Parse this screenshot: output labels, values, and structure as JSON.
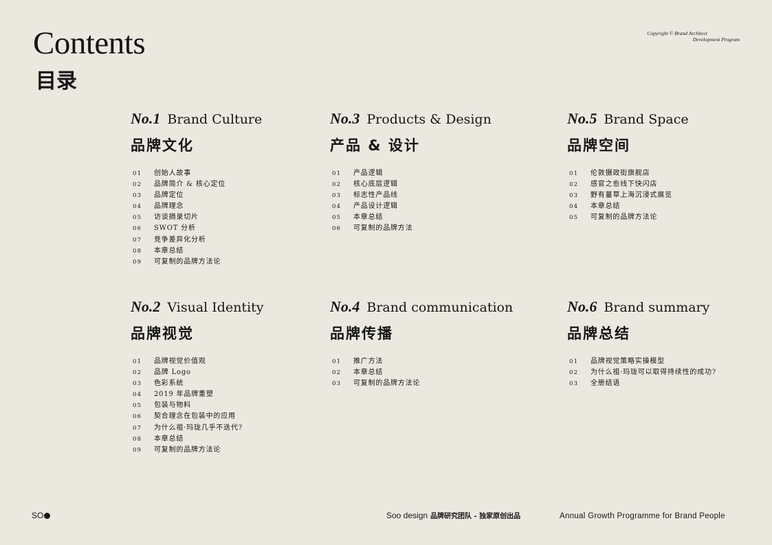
{
  "header": {
    "title_en": "Contents",
    "title_zh": "目录",
    "copyright_line1": "Copyright © Brand Architect",
    "copyright_line2": "Development Program"
  },
  "sections": [
    {
      "no": "No.1",
      "name": "Brand Culture",
      "zh": "品牌文化",
      "items": [
        {
          "num": "01",
          "label": "创始人故事"
        },
        {
          "num": "02",
          "label": "品牌简介 & 核心定位"
        },
        {
          "num": "03",
          "label": "品牌定位"
        },
        {
          "num": "04",
          "label": "品牌理念"
        },
        {
          "num": "05",
          "label": "访谈摘录切片"
        },
        {
          "num": "06",
          "label": "SWOT 分析"
        },
        {
          "num": "07",
          "label": "竞争差异化分析"
        },
        {
          "num": "08",
          "label": "本章总结"
        },
        {
          "num": "09",
          "label": "可复制的品牌方法论"
        }
      ]
    },
    {
      "no": "No.3",
      "name": "Products & Design",
      "zh": "产品 & 设计",
      "items": [
        {
          "num": "01",
          "label": "产品逻辑"
        },
        {
          "num": "02",
          "label": "核心底层逻辑"
        },
        {
          "num": "03",
          "label": "标志性产品线"
        },
        {
          "num": "04",
          "label": "产品设计逻辑"
        },
        {
          "num": "05",
          "label": "本章总结"
        },
        {
          "num": "06",
          "label": "可复制的品牌方法"
        }
      ]
    },
    {
      "no": "No.5",
      "name": "Brand Space",
      "zh": "品牌空间",
      "items": [
        {
          "num": "01",
          "label": "伦敦摄政街旗舰店"
        },
        {
          "num": "02",
          "label": "感官之愈线下快闪店"
        },
        {
          "num": "03",
          "label": "野有蔓草上海沉浸式展览"
        },
        {
          "num": "04",
          "label": "本章总结"
        },
        {
          "num": "05",
          "label": "可复制的品牌方法论"
        }
      ]
    },
    {
      "no": "No.2",
      "name": "Visual Identity",
      "zh": "品牌视觉",
      "items": [
        {
          "num": "01",
          "label": "品牌视觉价值观"
        },
        {
          "num": "02",
          "label": "品牌 Logo"
        },
        {
          "num": "03",
          "label": "色彩系统"
        },
        {
          "num": "04",
          "label": "2019 年品牌重塑"
        },
        {
          "num": "05",
          "label": "包装与物料"
        },
        {
          "num": "06",
          "label": "契合理念在包装中的应用"
        },
        {
          "num": "07",
          "label": "为什么祖·玛珑几乎不迭代?"
        },
        {
          "num": "08",
          "label": "本章总结"
        },
        {
          "num": "09",
          "label": "可复制的品牌方法论"
        }
      ]
    },
    {
      "no": "No.4",
      "name": "Brand communication",
      "zh": "品牌传播",
      "items": [
        {
          "num": "01",
          "label": "推广方法"
        },
        {
          "num": "02",
          "label": "本章总结"
        },
        {
          "num": "03",
          "label": "可复制的品牌方法论"
        }
      ]
    },
    {
      "no": "No.6",
      "name": "Brand summary",
      "zh": "品牌总结",
      "items": [
        {
          "num": "01",
          "label": "品牌视觉策略实操模型"
        },
        {
          "num": "02",
          "label": "为什么祖·玛珑可以取得持续性的成功?"
        },
        {
          "num": "03",
          "label": "全册结语"
        }
      ]
    }
  ],
  "footer": {
    "logo_text": "SO",
    "mid_en": "Soo design",
    "mid_zh": "品牌研究团队 - 独家原创出品",
    "right": "Annual Growth Programme for Brand People"
  }
}
